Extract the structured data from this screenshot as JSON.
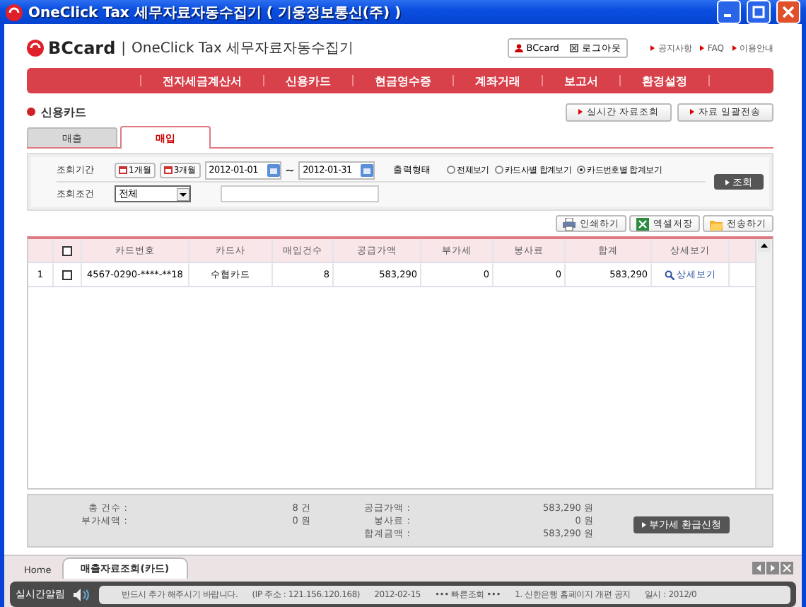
{
  "window": {
    "title": "OneClick Tax 세무자료자동수집기 ( 기웅정보통신(주) )"
  },
  "header": {
    "logo": "BCcard",
    "divider": "|",
    "app_name": "OneClick Tax 세무자료자동수집기",
    "user": "BCcard",
    "logout": "로그아웃",
    "links": [
      "공지사항",
      "FAQ",
      "이용안내"
    ]
  },
  "nav": [
    "전자세금계산서",
    "신용카드",
    "현금영수증",
    "계좌거래",
    "보고서",
    "환경설정"
  ],
  "section": {
    "title": "신용카드",
    "buttons": [
      "실시간 자료조회",
      "자료 일괄전송"
    ]
  },
  "tabs": [
    {
      "label": "매출",
      "selected": false
    },
    {
      "label": "매입",
      "selected": true
    }
  ],
  "filter": {
    "period_label": "조회기간",
    "quick_buttons": [
      "1개월",
      "3개월"
    ],
    "date_from": "2012-01-01",
    "separator": "~",
    "date_to": "2012-01-31",
    "output_label": "출력형태",
    "output_options": [
      {
        "label": "전체보기",
        "selected": false
      },
      {
        "label": "카드사별 합계보기",
        "selected": false
      },
      {
        "label": "카드번호별 합계보기",
        "selected": true
      }
    ],
    "condition_label": "조회조건",
    "condition_value": "전체",
    "search_button": "조회"
  },
  "actions": [
    {
      "label": "인쇄하기",
      "kind": "print"
    },
    {
      "label": "엑셀저장",
      "kind": "excel"
    },
    {
      "label": "전송하기",
      "kind": "folder"
    }
  ],
  "table": {
    "select_all_checked": false,
    "columns": [
      "카드번호",
      "카드사",
      "매입건수",
      "공급가액",
      "부가세",
      "봉사료",
      "합계",
      "상세보기"
    ],
    "rows": [
      {
        "index": "1",
        "checked": false,
        "cells": [
          "4567-0290-****-**18",
          "수협카드",
          "8",
          "583,290",
          "0",
          "0",
          "583,290"
        ],
        "link": "상세보기"
      }
    ]
  },
  "summary": {
    "left": [
      {
        "label": "총 건수 :",
        "value": "8 건"
      },
      {
        "label": "부가세액 :",
        "value": "0 원"
      }
    ],
    "right": [
      {
        "label": "공급가액 :",
        "value": "583,290 원"
      },
      {
        "label": "봉사료 :",
        "value": "0 원"
      },
      {
        "label": "합계금액 :",
        "value": "583,290 원"
      }
    ],
    "button": "부가세 환급신청"
  },
  "bottom_tabs": [
    {
      "label": "Home",
      "selected": false
    },
    {
      "label": "매출자료조회(카드)",
      "selected": true
    }
  ],
  "ticker": {
    "label": "실시간알림",
    "items": [
      "반드시 추가 해주시기 바랍니다.",
      "(IP 주소 : 121.156.120.168)",
      "2012-02-15",
      "••• 빠른조회 •••",
      "1. 신한은행 홈페이지 개편 공지",
      "일시 : 2012/0"
    ]
  }
}
